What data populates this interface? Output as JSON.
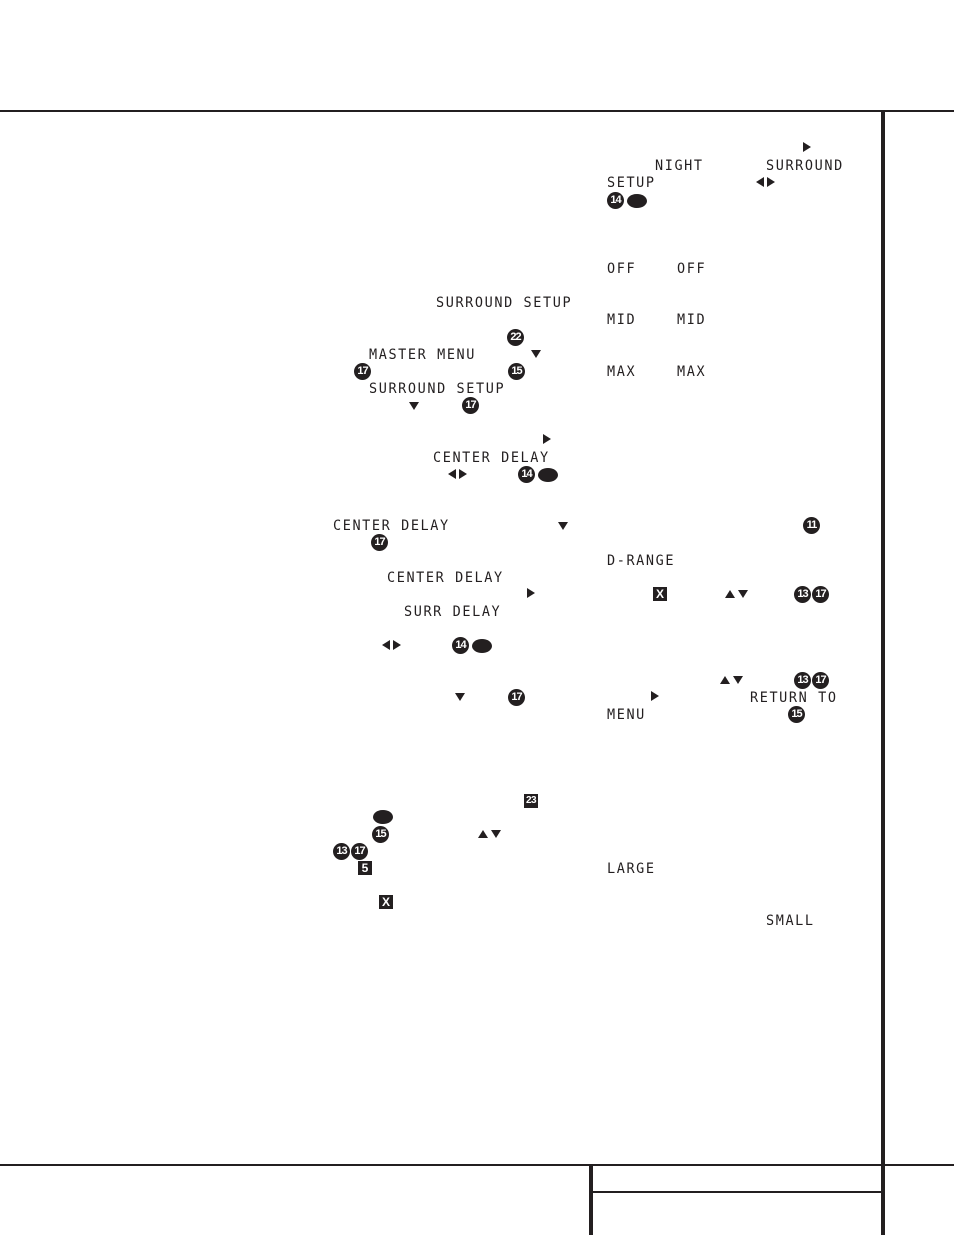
{
  "page": {
    "colors": {
      "ink": "#231f20",
      "paper": "#ffffff"
    }
  },
  "left_column": {
    "labels": {
      "surround_setup_1": "SURROUND SETUP",
      "master_menu": "MASTER MENU",
      "surround_setup_2": "SURROUND SETUP",
      "center_delay_1": "CENTER DELAY",
      "center_delay_2": "CENTER DELAY",
      "center_delay_3": "CENTER DELAY",
      "surr_delay": "SURR DELAY"
    },
    "callouts": {
      "c22": "22",
      "c17a": "17",
      "c15a": "15",
      "c17b": "17",
      "c14a": "14",
      "c17c": "17",
      "c14b": "14",
      "c17d": "17",
      "c23": "23",
      "c15b": "15",
      "c13": "13",
      "c17e": "17",
      "c5": "5",
      "cx": "X"
    }
  },
  "right_column": {
    "labels": {
      "night": "NIGHT",
      "surround": "SURROUND",
      "setup": "SETUP",
      "off_1": "OFF",
      "off_2": "OFF",
      "mid_1": "MID",
      "mid_2": "MID",
      "max_1": "MAX",
      "max_2": "MAX",
      "d_range": "D-RANGE",
      "return_to": "RETURN TO",
      "menu": "MENU",
      "large": "LARGE",
      "small": "SMALL"
    },
    "callouts": {
      "c14": "14",
      "c11": "11",
      "cx": "X",
      "c13a": "13",
      "c17a": "17",
      "c13b": "13",
      "c17b": "17",
      "c15": "15"
    }
  }
}
